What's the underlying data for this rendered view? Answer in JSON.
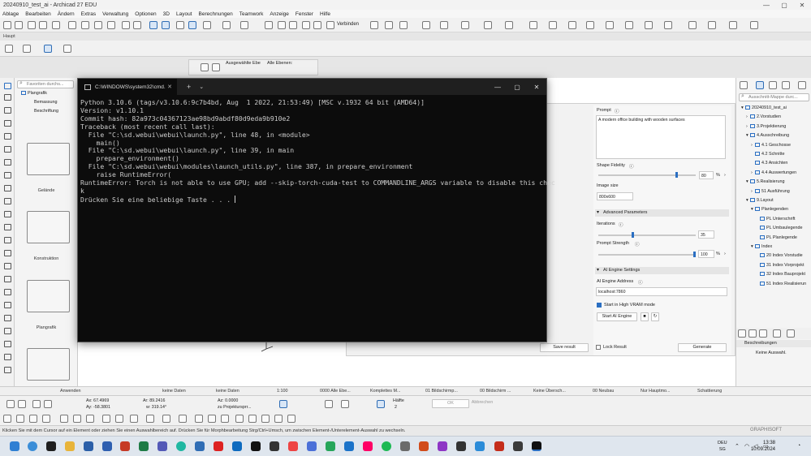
{
  "app": {
    "title": "20240910_test_ai - Archicad 27 EDU",
    "window_controls": [
      "—",
      "▢",
      "✕"
    ]
  },
  "menu": [
    "Ablage",
    "Bearbeiten",
    "Ändern",
    "Extras",
    "Verwaltung",
    "Optionen",
    "3D",
    "Layout",
    "Berechnungen",
    "Teamwork",
    "Anzeige",
    "Fenster",
    "Hilfe"
  ],
  "toolbar": {
    "verbinden": "Verbinden",
    "haupt": "Haupt"
  },
  "infobox": {
    "selected_level": "Ausgewählte Ebe",
    "all_levels": "Alle Ebenen:"
  },
  "navigator": {
    "search_placeholder": "Favoriten durchs...",
    "tree": [
      "Plangrafik",
      "Bemassung",
      "Beschriftung"
    ],
    "folders": [
      "Gelände",
      "Konstruktion",
      "Plangrafik"
    ]
  },
  "terminal": {
    "tab_title": "C:\\WINDOWS\\system32\\cmd.",
    "lines": [
      "Python 3.10.6 (tags/v3.10.6:9c7b4bd, Aug  1 2022, 21:53:49) [MSC v.1932 64 bit (AMD64)]",
      "Version: v1.10.1",
      "Commit hash: 82a973c04367123ae98bd9abdf80d9eda9b910e2",
      "Traceback (most recent call last):",
      "  File \"C:\\sd.webui\\webui\\launch.py\", line 48, in <module>",
      "    main()",
      "  File \"C:\\sd.webui\\webui\\launch.py\", line 39, in main",
      "    prepare_environment()",
      "  File \"C:\\sd.webui\\webui\\modules\\launch_utils.py\", line 387, in prepare_environment",
      "    raise RuntimeError(",
      "RuntimeError: Torch is not able to use GPU; add --skip-torch-cuda-test to COMMANDLINE_ARGS variable to disable this chec",
      "k",
      "Drücken Sie eine beliebige Taste . . . "
    ]
  },
  "ai_panel": {
    "prompt_label": "Prompt",
    "prompt_value": "A modern office building with wooden surfaces",
    "shape_fidelity_label": "Shape Fidelity",
    "shape_fidelity_value": "80",
    "shape_fidelity": 0.8,
    "image_size_label": "Image size",
    "image_size_value": "800x600",
    "advanced_header": "Advanced Parameters",
    "iterations_label": "Iterations",
    "iterations_value": "35",
    "iterations": 0.35,
    "strength_label": "Prompt Strength",
    "strength_value": "100",
    "strength": 1.0,
    "percent": "%",
    "engine_header": "AI Engine Settings",
    "engine_address_label": "AI Engine Address",
    "engine_address_value": "localhost:7860",
    "high_vram_label": "Start in High VRAM mode",
    "start_engine_label": "Start AI Engine",
    "save_result_label": "Save result",
    "lock_result_label": "Lock Result",
    "generate_label": "Generate"
  },
  "right_panel": {
    "search_placeholder": "Ausschnitt-Mappe durc...",
    "tree": [
      {
        "label": "20240910_test_ai",
        "level": 0,
        "prefix": "▾"
      },
      {
        "label": "2.Vorstudien",
        "level": 1,
        "prefix": "›"
      },
      {
        "label": "3.Projektierung",
        "level": 1,
        "prefix": "›"
      },
      {
        "label": "4.Ausschreibung",
        "level": 1,
        "prefix": "▾"
      },
      {
        "label": "4.1 Geschosse",
        "level": 2,
        "prefix": "›"
      },
      {
        "label": "4.2 Schnitte",
        "level": 2,
        "prefix": ""
      },
      {
        "label": "4.3 Ansichten",
        "level": 2,
        "prefix": ""
      },
      {
        "label": "4.4 Auswertungen",
        "level": 2,
        "prefix": "›"
      },
      {
        "label": "5.Realisierung",
        "level": 1,
        "prefix": "▾"
      },
      {
        "label": "51 Ausführung",
        "level": 2,
        "prefix": "›"
      },
      {
        "label": "9.Layout",
        "level": 1,
        "prefix": "▾"
      },
      {
        "label": "Planlegenden",
        "level": 2,
        "prefix": "▾"
      },
      {
        "label": "PL Unterschrift",
        "level": 3,
        "prefix": ""
      },
      {
        "label": "PL Umbaulegende",
        "level": 3,
        "prefix": ""
      },
      {
        "label": "PL Planlegende",
        "level": 3,
        "prefix": ""
      },
      {
        "label": "Index",
        "level": 2,
        "prefix": "▾"
      },
      {
        "label": "20 Index Vorstudie",
        "level": 3,
        "prefix": ""
      },
      {
        "label": "31 Index Vorprojekt",
        "level": 3,
        "prefix": ""
      },
      {
        "label": "32 Index Bauprojekt",
        "level": 3,
        "prefix": ""
      },
      {
        "label": "51 Index Realisierun",
        "level": 3,
        "prefix": ""
      }
    ],
    "descriptions_header": "Beschreibungen",
    "no_selection": "Keine Auswahl."
  },
  "statusbar": {
    "apply": "Anwenden",
    "nodata1": "keine Daten",
    "nodata2": "keine Daten",
    "scale": "1:100",
    "layers": "0000 Alle Ebe...",
    "model": "Komplettes M...",
    "screen1": "01 Bildschirmp...",
    "screen2": "00 Bildschirm ...",
    "overrides": "Keine Übersch...",
    "renovation": "00 Neubau",
    "main": "Nur Hauptmo...",
    "shading": "Schattierung"
  },
  "coords": {
    "ax": "Ax: 67.4969",
    "ay": "Ay: -58.3801",
    "ar": "Ar: 89.2416",
    "aw": "w: 319.14°",
    "az": "Az: 0.0000",
    "proj": "zu Projektursprr...",
    "half": "Hälfte",
    "half_n": "2",
    "ok": "OK",
    "cancel": "Abbrechen"
  },
  "hint": "Klicken Sie mit dem Cursor auf ein Element oder ziehen Sie einen Auswahlbereich auf. Drücken Sie für Morphbearbeitung Strg/Ctrl+Umsch, um zwischen Element-/Unterelement-Auswahl zu wechseln.",
  "graphisoft": "GRAPHISOFT",
  "taskbar": {
    "lang1": "DEU",
    "lang2": "SG",
    "time": "13:38",
    "date": "10.09.2024"
  }
}
